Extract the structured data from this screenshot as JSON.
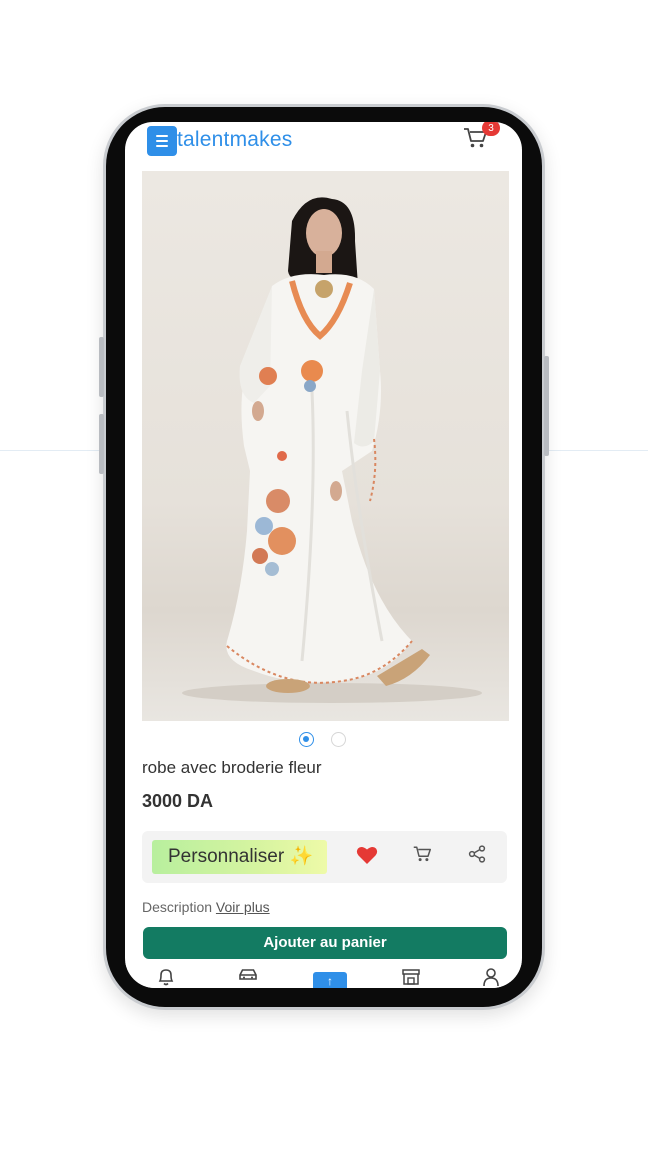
{
  "header": {
    "brand": "talentmakes",
    "cart_count": "3"
  },
  "product": {
    "title": "robe avec broderie fleur",
    "price": "3000 DA",
    "image_alt": "white embroidered kaftan dress",
    "gallery": {
      "current": 1,
      "total": 2
    }
  },
  "actions": {
    "personalize_label": "Personnaliser ✨",
    "favorite_color": "#e53935"
  },
  "description": {
    "label": "Description",
    "link": "Voir plus"
  },
  "add_to_cart_label": "Ajouter au panier",
  "bottom_nav": {
    "items": [
      "bell-icon",
      "car-icon",
      "upload-icon",
      "store-icon",
      "user-icon"
    ]
  },
  "colors": {
    "accent": "#2f8fe8",
    "primary_button": "#137b62",
    "badge": "#e53935"
  }
}
